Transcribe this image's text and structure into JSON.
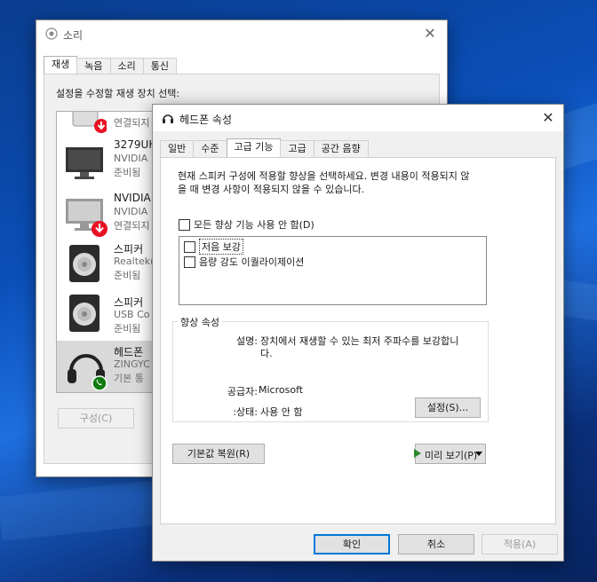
{
  "sound_window": {
    "title": "소리",
    "tabs": [
      "재생",
      "녹음",
      "소리",
      "통신"
    ],
    "instruction": "설정을 수정할 재생 장치 선택:",
    "devices": [
      {
        "name": "",
        "line2": "",
        "line3": "연결되지",
        "icon": "speaker-disconnected-icon"
      },
      {
        "name": "3279UH",
        "line2": "NVIDIA",
        "line3": "준비됨",
        "icon": "monitor-icon"
      },
      {
        "name": "NVIDIA",
        "line2": "NVIDIA",
        "line3": "연결되지",
        "icon": "monitor-disconnected-icon"
      },
      {
        "name": "스피커",
        "line2": "Realtek(",
        "line3": "준비됨",
        "icon": "speaker-icon"
      },
      {
        "name": "스피커",
        "line2": "USB Co",
        "line3": "준비됨",
        "icon": "speaker-icon"
      },
      {
        "name": "헤드폰",
        "line2": "ZINGYC",
        "line3": "기본 통",
        "icon": "headphones-icon"
      }
    ],
    "configure_button": "구성(C)"
  },
  "props_window": {
    "title": "헤드폰 속성",
    "tabs": [
      "일반",
      "수준",
      "고급 기능",
      "고급",
      "공간 음향"
    ],
    "active_tab": "고급 기능",
    "description_line1": "현재 스피커 구성에 적용할 향상을 선택하세요. 변경 내용이 적용되지 않",
    "description_line2": "을 때 변경 사항이 적용되지 않을 수 있습니다.",
    "disable_all_label": "모든 향상 기능 사용 안 함(D)",
    "enhancements": [
      "저음 보강",
      "음량 강도 이퀄라이제이션"
    ],
    "group_title": "향상 속성",
    "description_label": "설명:",
    "description_value_line1": "장치에서 재생할 수 있는 최저 주파수를 보강합니",
    "description_value_line2": "다.",
    "provider_label": "공급자:",
    "provider_value": "Microsoft",
    "status_label": ":상태:",
    "status_value": "사용 안 함",
    "settings_button": "설정(S)...",
    "restore_defaults_button": "기본값 복원(R)",
    "preview_button": "미리 보기(P)",
    "ok_button": "확인",
    "cancel_button": "취소",
    "apply_button": "적용(A)"
  },
  "colors": {
    "accent": "#0078d7",
    "selection": "#cce8ff",
    "disconnect_red": "#e81123",
    "phone_green": "#107c10"
  }
}
